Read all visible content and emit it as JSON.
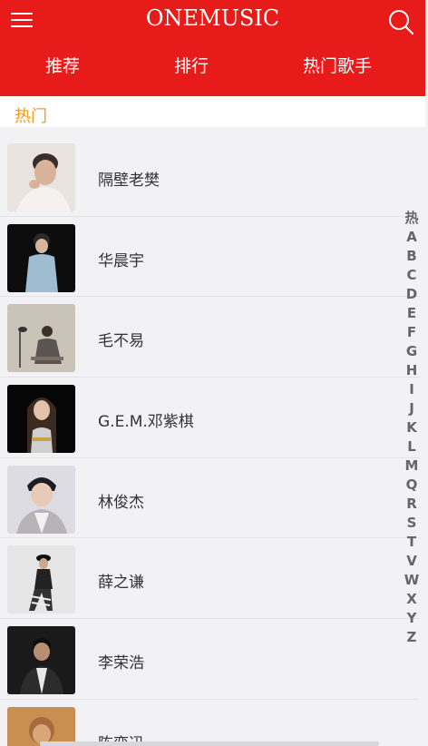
{
  "header": {
    "logo": "ONEMUSIC",
    "menu_icon": "hamburger-menu-icon",
    "search_icon": "search-icon",
    "background": "#e81b1b"
  },
  "tabs": [
    {
      "label": "推荐"
    },
    {
      "label": "排行"
    },
    {
      "label": "热门歌手"
    }
  ],
  "section": {
    "title": "热门",
    "color": "#f29b21"
  },
  "singers": [
    {
      "name": "隔壁老樊"
    },
    {
      "name": "华晨宇"
    },
    {
      "name": "毛不易"
    },
    {
      "name": "G.E.M.邓紫棋"
    },
    {
      "name": "林俊杰"
    },
    {
      "name": "薛之谦"
    },
    {
      "name": "李荣浩"
    },
    {
      "name": "陈奕迅"
    }
  ],
  "index": [
    "热",
    "A",
    "B",
    "C",
    "D",
    "E",
    "F",
    "G",
    "H",
    "I",
    "J",
    "K",
    "L",
    "M",
    "Q",
    "R",
    "S",
    "T",
    "V",
    "W",
    "X",
    "Y",
    "Z"
  ]
}
